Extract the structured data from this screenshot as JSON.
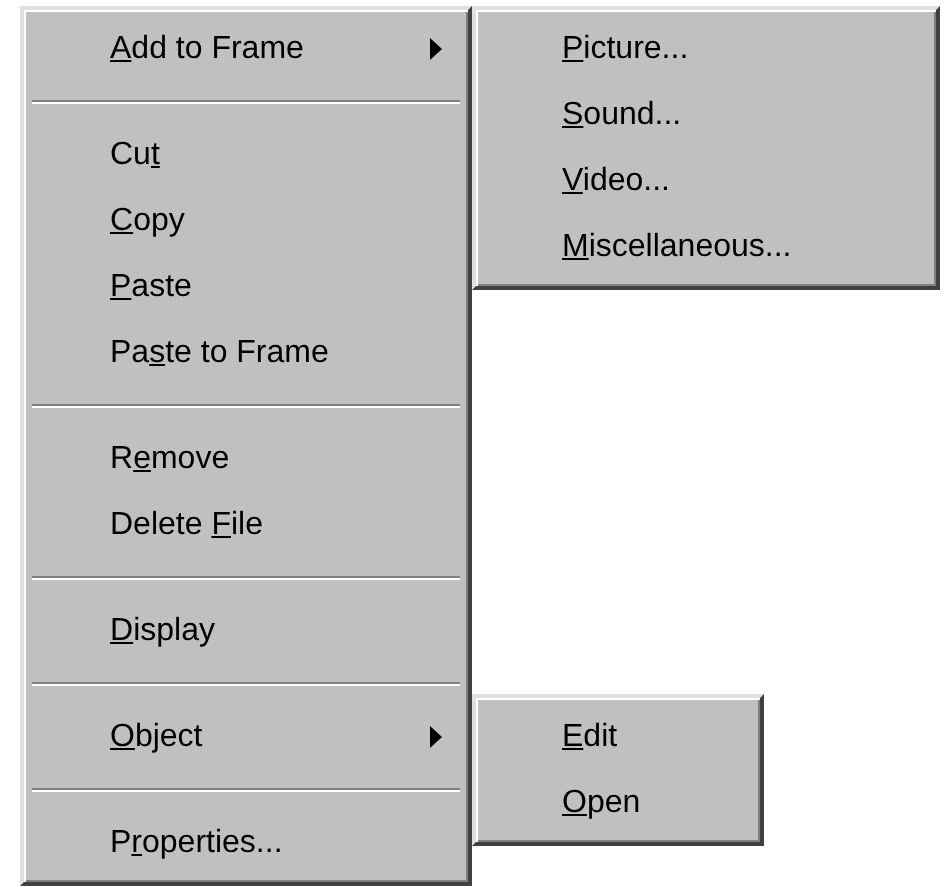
{
  "context_menu": {
    "groups": [
      [
        {
          "label": [
            {
              "text": "A",
              "underline": true
            },
            {
              "text": "dd to Frame",
              "underline": false
            }
          ],
          "submenu": [
            {
              "label": [
                {
                  "text": "P",
                  "underline": true
                },
                {
                  "text": "icture...",
                  "underline": false
                }
              ]
            },
            {
              "label": [
                {
                  "text": "S",
                  "underline": true
                },
                {
                  "text": "ound...",
                  "underline": false
                }
              ]
            },
            {
              "label": [
                {
                  "text": "V",
                  "underline": true
                },
                {
                  "text": "ideo...",
                  "underline": false
                }
              ]
            },
            {
              "label": [
                {
                  "text": "M",
                  "underline": true
                },
                {
                  "text": "iscellaneous...",
                  "underline": false
                }
              ]
            }
          ]
        }
      ],
      [
        {
          "label": [
            {
              "text": "Cu",
              "underline": false
            },
            {
              "text": "t",
              "underline": true
            }
          ]
        },
        {
          "label": [
            {
              "text": "C",
              "underline": true
            },
            {
              "text": "opy",
              "underline": false
            }
          ]
        },
        {
          "label": [
            {
              "text": "P",
              "underline": true
            },
            {
              "text": "aste",
              "underline": false
            }
          ]
        },
        {
          "label": [
            {
              "text": "Pa",
              "underline": false
            },
            {
              "text": "s",
              "underline": true
            },
            {
              "text": "te to Frame",
              "underline": false
            }
          ]
        }
      ],
      [
        {
          "label": [
            {
              "text": "R",
              "underline": false
            },
            {
              "text": "e",
              "underline": true
            },
            {
              "text": "move",
              "underline": false
            }
          ]
        },
        {
          "label": [
            {
              "text": "Delete ",
              "underline": false
            },
            {
              "text": "F",
              "underline": true
            },
            {
              "text": "ile",
              "underline": false
            }
          ]
        }
      ],
      [
        {
          "label": [
            {
              "text": "D",
              "underline": true
            },
            {
              "text": "isplay",
              "underline": false
            }
          ]
        }
      ],
      [
        {
          "label": [
            {
              "text": "O",
              "underline": true
            },
            {
              "text": "bject",
              "underline": false
            }
          ],
          "submenu": [
            {
              "label": [
                {
                  "text": "E",
                  "underline": true
                },
                {
                  "text": "dit",
                  "underline": false
                }
              ]
            },
            {
              "label": [
                {
                  "text": "O",
                  "underline": true
                },
                {
                  "text": "pen",
                  "underline": false
                }
              ]
            }
          ]
        }
      ],
      [
        {
          "label": [
            {
              "text": "P",
              "underline": false
            },
            {
              "text": "r",
              "underline": true
            },
            {
              "text": "operties...",
              "underline": false
            }
          ]
        }
      ]
    ]
  }
}
